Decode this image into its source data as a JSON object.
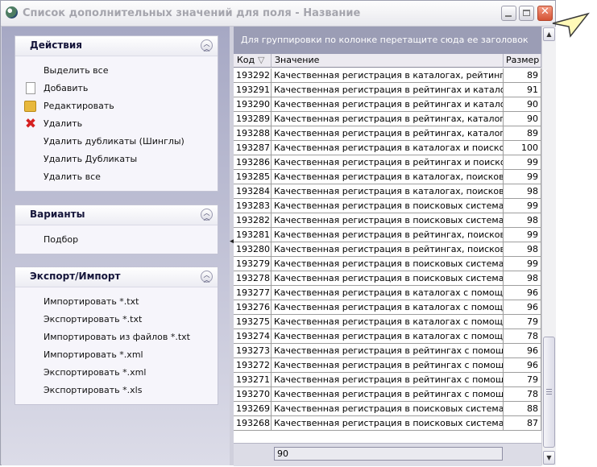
{
  "window": {
    "title": "Список дополнительных значений для поля - Название"
  },
  "panels": {
    "actions": {
      "title": "Действия",
      "items": [
        "Выделить все",
        "Добавить",
        "Редактировать",
        "Удалить",
        "Удалить дубликаты (Шинглы)",
        "Удалить Дубликаты",
        "Удалить все"
      ]
    },
    "variants": {
      "title": "Варианты",
      "items": [
        "Подбор"
      ]
    },
    "export": {
      "title": "Экспорт/Импорт",
      "items": [
        "Импортировать *.txt",
        "Экспортировать *.txt",
        "Импортировать из файлов *.txt",
        "Импортировать *.xml",
        "Экспортировать *.xml",
        "Экспортировать *.xls"
      ]
    }
  },
  "grid": {
    "group_hint": "Для группировки по колонке перетащите сюда ее заголовок",
    "columns": [
      "Код",
      "Значение",
      "Размер"
    ],
    "rows": [
      {
        "code": "193292",
        "value": "Качественная регистрация в каталогах, рейтингах с пом",
        "size": "89"
      },
      {
        "code": "193291",
        "value": "Качественная регистрация в рейтингах и каталогах с пом",
        "size": "91"
      },
      {
        "code": "193290",
        "value": "Качественная регистрация в рейтингах и каталогах с по",
        "size": "90"
      },
      {
        "code": "193289",
        "value": "Качественная регистрация в рейтингах, каталогах с пом",
        "size": "90"
      },
      {
        "code": "193288",
        "value": "Качественная регистрация в рейтингах, каталогах с пом",
        "size": "89"
      },
      {
        "code": "193287",
        "value": "Качественная регистрация в каталогах и поисковых си",
        "size": "100"
      },
      {
        "code": "193286",
        "value": "Качественная регистрация в рейтингах и поисковых си",
        "size": "99"
      },
      {
        "code": "193285",
        "value": "Качественная регистрация в каталогах, поисковых сист",
        "size": "99"
      },
      {
        "code": "193284",
        "value": "Качественная регистрация в каталогах, поисковых сист",
        "size": "98"
      },
      {
        "code": "193283",
        "value": "Качественная регистрация в поисковых системах, катал",
        "size": "99"
      },
      {
        "code": "193282",
        "value": "Качественная регистрация в поисковых системах, катал",
        "size": "98"
      },
      {
        "code": "193281",
        "value": "Качественная регистрация в рейтингах, поисковых сист",
        "size": "99"
      },
      {
        "code": "193280",
        "value": "Качественная регистрация в рейтингах, поисковых сист",
        "size": "98"
      },
      {
        "code": "193279",
        "value": "Качественная регистрация в поисковых системах, рейт",
        "size": "99"
      },
      {
        "code": "193278",
        "value": "Качественная регистрация в поисковых системах, рейт",
        "size": "98"
      },
      {
        "code": "193277",
        "value": "Качественная регистрация в каталогах с помощью над",
        "size": "96"
      },
      {
        "code": "193276",
        "value": "Качественная регистрация в каталогах с помощью удо",
        "size": "96"
      },
      {
        "code": "193275",
        "value": "Качественная регистрация в каталогах с помощью над",
        "size": "79"
      },
      {
        "code": "193274",
        "value": "Качественная регистрация в каталогах с помощью удо",
        "size": "78"
      },
      {
        "code": "193273",
        "value": "Качественная регистрация в рейтингах с помощью над",
        "size": "96"
      },
      {
        "code": "193272",
        "value": "Качественная регистрация в рейтингах с помощью удо",
        "size": "96"
      },
      {
        "code": "193271",
        "value": "Качественная регистрация в рейтингах с помощью над",
        "size": "79"
      },
      {
        "code": "193270",
        "value": "Качественная регистрация в рейтингах с помощью удо",
        "size": "78"
      },
      {
        "code": "193269",
        "value": "Качественная регистрация в поисковых системах с пом",
        "size": "88"
      },
      {
        "code": "193268",
        "value": "Качественная регистрация в поисковых системах с пом",
        "size": "87"
      }
    ],
    "footer_value": "90"
  },
  "colors": {
    "title_text": "#a5a5ad",
    "group_panel": "#9b9db5",
    "left_pane": "#a6a8c4",
    "close_button": "#d45335"
  },
  "icons": {
    "add": "document-icon",
    "edit": "folder-icon",
    "delete": "red-x-icon"
  }
}
